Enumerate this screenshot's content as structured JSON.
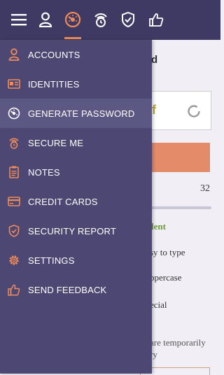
{
  "topbar": {
    "icons": [
      "menu-icon",
      "user-icon",
      "password-generator-icon",
      "secure-me-icon",
      "shield-check-icon",
      "thumbs-up-icon"
    ],
    "active": "password-generator-icon",
    "accent": "#ef8b5a"
  },
  "drawer": {
    "items": [
      {
        "label": "ACCOUNTS",
        "icon": "user-icon"
      },
      {
        "label": "IDENTITIES",
        "icon": "id-card-icon"
      },
      {
        "label": "GENERATE PASSWORD",
        "icon": "password-generator-icon",
        "active": true
      },
      {
        "label": "SECURE ME",
        "icon": "secure-me-icon"
      },
      {
        "label": "NOTES",
        "icon": "notes-icon"
      },
      {
        "label": "CREDIT CARDS",
        "icon": "credit-card-icon"
      },
      {
        "label": "SECURITY REPORT",
        "icon": "shield-check-icon"
      },
      {
        "label": "SETTINGS",
        "icon": "gear-icon"
      },
      {
        "label": "SEND FEEDBACK",
        "icon": "thumbs-up-icon"
      }
    ]
  },
  "background": {
    "title_fragment": "d",
    "password_fragment": "lf",
    "length_value": "32",
    "strength_fragment": "lent",
    "options": [
      "sy to type",
      "ppercase",
      "ecial"
    ],
    "note_lines": [
      "are temporarily",
      "ry"
    ]
  },
  "colors": {
    "topbar": "#3f3a63",
    "drawer": "#4d4873",
    "drawer_active": "#5c5884",
    "icon_accent": "#ef8b5a",
    "generate_button": "#e48c69",
    "strength_text": "#6b9a3a"
  }
}
